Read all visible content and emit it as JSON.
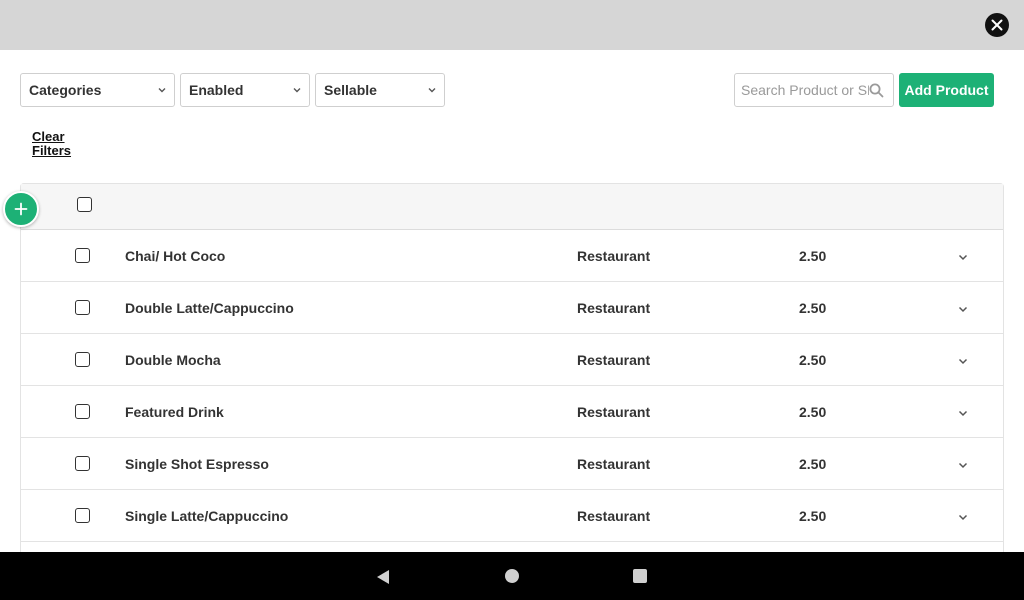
{
  "filters": {
    "category": "Categories",
    "status": "Enabled",
    "sellable": "Sellable"
  },
  "search": {
    "placeholder": "Search Product or SKU"
  },
  "add_button": "Add Product",
  "clear_filters": "Clear Filters",
  "products": [
    {
      "name": "Chai/ Hot Coco",
      "category": "Restaurant",
      "price": "2.50"
    },
    {
      "name": "Double Latte/Cappuccino",
      "category": "Restaurant",
      "price": "2.50"
    },
    {
      "name": "Double Mocha",
      "category": "Restaurant",
      "price": "2.50"
    },
    {
      "name": "Featured Drink",
      "category": "Restaurant",
      "price": "2.50"
    },
    {
      "name": "Single Shot Espresso",
      "category": "Restaurant",
      "price": "2.50"
    },
    {
      "name": "Single Latte/Cappuccino",
      "category": "Restaurant",
      "price": "2.50"
    }
  ],
  "colors": {
    "accent": "#1db176",
    "topbar": "#d6d6d6",
    "navbar": "#000000"
  },
  "icons": [
    "close-icon",
    "chevron-down-icon",
    "search-icon",
    "plus-icon",
    "nav-back-icon",
    "nav-home-icon",
    "nav-recents-icon"
  ]
}
